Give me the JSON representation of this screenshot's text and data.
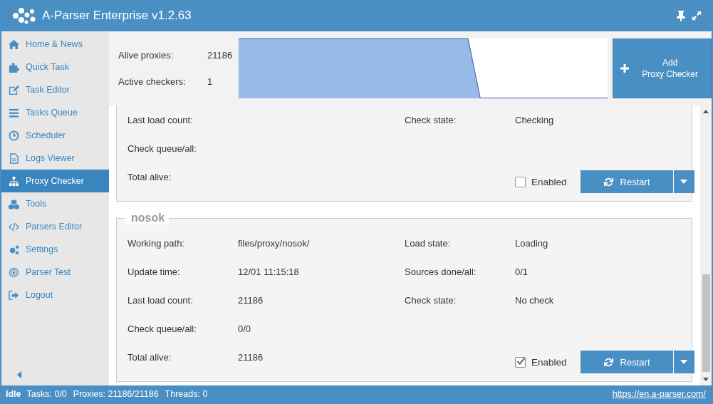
{
  "window": {
    "title": "A-Parser Enterprise v1.2.63"
  },
  "sidebar": {
    "items": [
      {
        "label": "Home & News",
        "selected": false
      },
      {
        "label": "Quick Task",
        "selected": false
      },
      {
        "label": "Task Editor",
        "selected": false
      },
      {
        "label": "Tasks Queue",
        "selected": false
      },
      {
        "label": "Scheduler",
        "selected": false
      },
      {
        "label": "Logs Viewer",
        "selected": false
      },
      {
        "label": "Proxy Checker",
        "selected": true
      },
      {
        "label": "Tools",
        "selected": false
      },
      {
        "label": "Parsers Editor",
        "selected": false
      },
      {
        "label": "Settings",
        "selected": false
      },
      {
        "label": "Parser Test",
        "selected": false
      },
      {
        "label": "Logout",
        "selected": false
      }
    ]
  },
  "summary": {
    "stats": [
      {
        "label": "Alive proxies:",
        "value": "21186"
      },
      {
        "label": "Active checkers:",
        "value": "1"
      }
    ],
    "add_button": [
      "Add",
      "Proxy Checker"
    ]
  },
  "checkers": [
    {
      "enabled": false,
      "enabled_label": "Enabled",
      "restart_label": "Restart",
      "rows": [
        {
          "label": "Last load count:",
          "label_2": "Check state:",
          "value_2": "Checking"
        },
        {
          "label": "Check queue/all:"
        },
        {
          "label": "Total alive:"
        }
      ]
    },
    {
      "name": "nosok",
      "enabled": true,
      "enabled_label": "Enabled",
      "restart_label": "Restart",
      "rows": [
        {
          "label": "Working path:",
          "value": "files/proxy/nosok/",
          "label_2": "Load state:",
          "value_2": "Loading"
        },
        {
          "label": "Update time:",
          "value": "12/01 11:15:18",
          "label_2": "Sources done/all:",
          "value_2": "0/1"
        },
        {
          "label": "Last load count:",
          "value": "21186",
          "label_2": "Check state:",
          "value_2": "No check"
        },
        {
          "label": "Check queue/all:",
          "value": "0/0"
        },
        {
          "label": "Total alive:",
          "value": "21186"
        }
      ]
    }
  ],
  "status_bar": {
    "state": "Idle",
    "items": [
      "Tasks: 0/0",
      "Proxies: 21186/21186",
      "Threads: 0"
    ],
    "link": "https://en.a-parser.com/"
  }
}
